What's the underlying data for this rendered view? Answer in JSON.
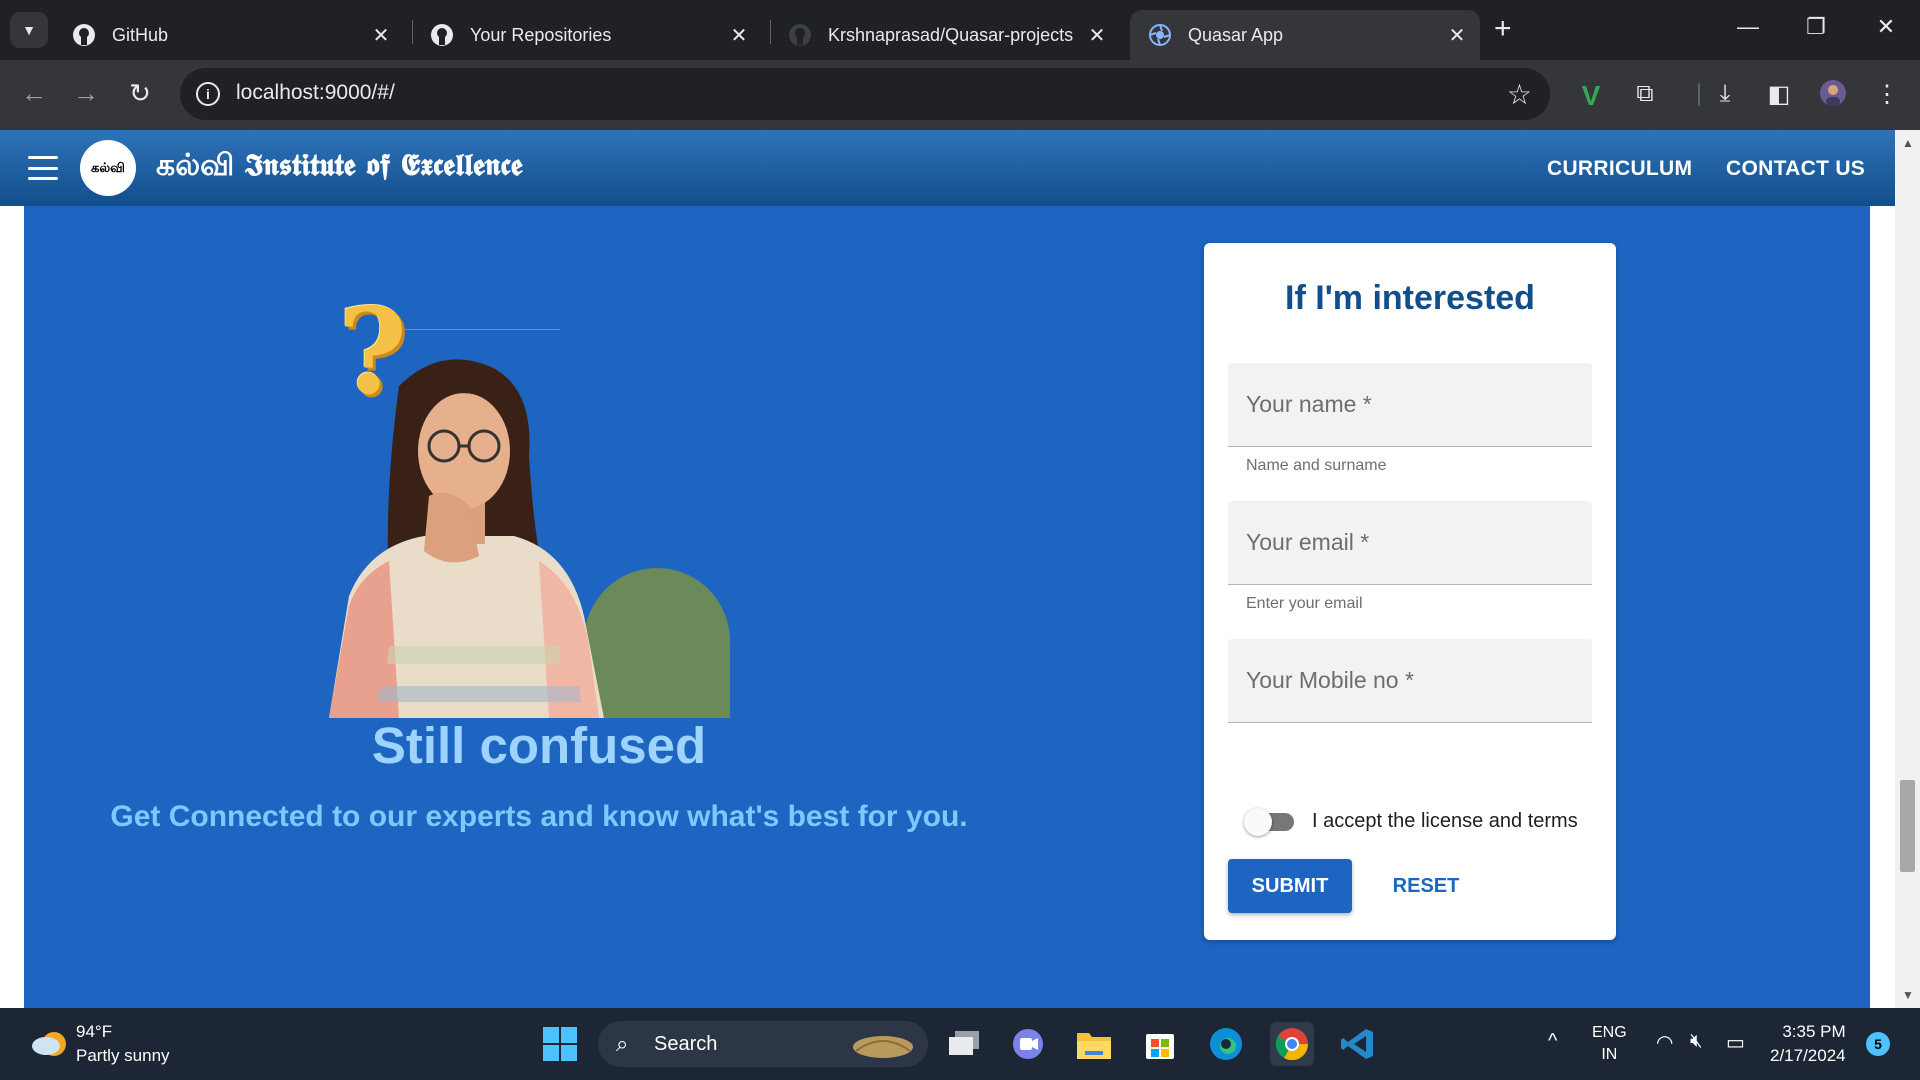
{
  "browser": {
    "tabs": [
      {
        "title": "GitHub",
        "icon": "github-icon",
        "active": false
      },
      {
        "title": "Your Repositories",
        "icon": "github-icon",
        "active": false
      },
      {
        "title": "Krshnaprasad/Quasar-projects",
        "icon": "github-icon",
        "active": false
      },
      {
        "title": "Quasar App",
        "icon": "quasar-icon",
        "active": true
      }
    ],
    "url": "localhost:9000/#/"
  },
  "site": {
    "logo_text": "கல்வி",
    "brand_title": "கல்வி 𝕴𝖓𝖘𝖙𝖎𝖙𝖚𝖙𝖊 𝖔𝖋 𝕰𝖝𝖈𝖊𝖑𝖑𝖊𝖓𝖈𝖊",
    "nav": [
      "CURRICULUM",
      "CONTACT US"
    ]
  },
  "hero": {
    "question_mark": "?",
    "title": "Still confused",
    "subtitle": "Get Connected to our experts and know what's best for you."
  },
  "form": {
    "heading": "If I'm interested",
    "fields": [
      {
        "label": "Your name *",
        "hint": "Name and surname"
      },
      {
        "label": "Your email *",
        "hint": "Enter your email"
      },
      {
        "label": "Your Mobile no *",
        "hint": ""
      }
    ],
    "toggle_label": "I accept the license and terms",
    "toggle_on": false,
    "submit_label": "SUBMIT",
    "reset_label": "RESET"
  },
  "taskbar": {
    "weather_temp": "94°F",
    "weather_desc": "Partly sunny",
    "search_label": "Search",
    "lang_top": "ENG",
    "lang_bottom": "IN",
    "time": "3:35 PM",
    "date": "2/17/2024",
    "notifications": "5"
  },
  "colors": {
    "page_blue": "#1d65c1",
    "header_blue": "#124e8c",
    "title_light_blue": "#9cd4ff"
  }
}
